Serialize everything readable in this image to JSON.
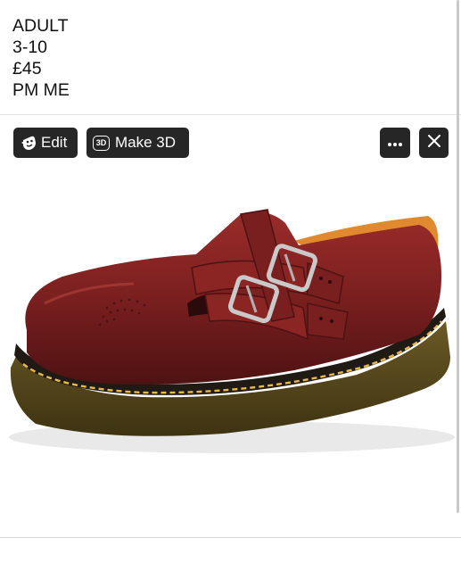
{
  "post": {
    "lines": [
      "ADULT",
      "3-10",
      "£45",
      "PM ME"
    ]
  },
  "toolbar": {
    "edit_label": "Edit",
    "make3d_label": "Make 3D",
    "make3d_badge": "3D",
    "more_icon": "more-horizontal-icon",
    "close_icon": "close-icon",
    "button_bg": "#262626"
  },
  "photo": {
    "subject": "burgundy leather Mary Jane shoe with two buckle straps",
    "shoe_color": "#7a1f1f",
    "sole_color": "#5a4a1c",
    "stitch_color": "#e8b84a"
  }
}
